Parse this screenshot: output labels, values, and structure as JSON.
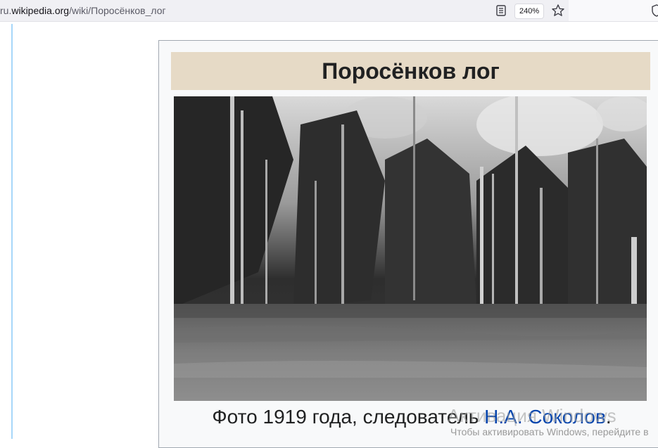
{
  "browser": {
    "url_prefix": "ru.",
    "url_host": "wikipedia.org",
    "url_path": "/wiki/Поросёнков_лог",
    "zoom": "240%",
    "icons": [
      "reader-mode-icon",
      "star-icon",
      "shield-icon"
    ]
  },
  "infobox": {
    "title": "Поросёнков лог",
    "caption_prefix": "Фото 1919 года, следователь ",
    "caption_link": "Н.А. Соколов",
    "caption_suffix": "."
  },
  "os_overlay": {
    "activation_title": "Активация Windows",
    "activation_text": "Чтобы активировать Windows, перейдите в"
  },
  "colors": {
    "title_bg": "#e6dac6",
    "link": "#0645ad",
    "infobox_border": "#a2a9b1"
  }
}
